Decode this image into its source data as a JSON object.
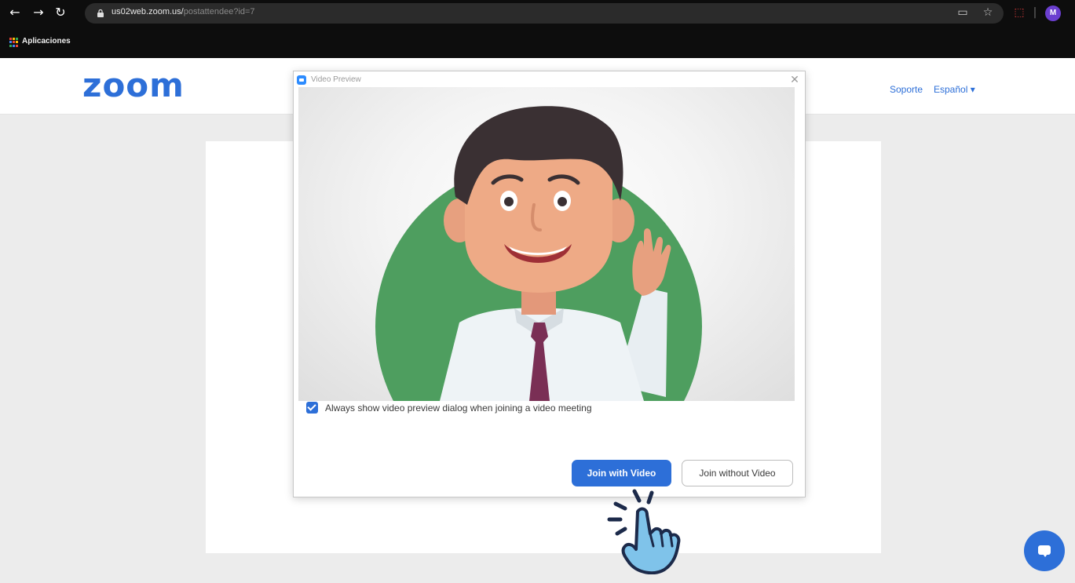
{
  "browser": {
    "url_host": "us02web.zoom.us/",
    "url_path": "postattendee?id=7",
    "back_icon": "back-arrow-icon",
    "forward_icon": "forward-arrow-icon",
    "reload_icon": "reload-icon",
    "profile_initial": "M",
    "bookmarks": {
      "apps_label": "Aplicaciones"
    }
  },
  "header": {
    "logo": "zoom",
    "support_link": "Soporte",
    "language_link": "Español ▾"
  },
  "dialog": {
    "title": "Video Preview",
    "close_label": "✕",
    "checkbox_label": "Always show video preview dialog when joining a video meeting",
    "checkbox_checked": true,
    "join_video_label": "Join with Video",
    "join_without_video_label": "Join without Video"
  },
  "colors": {
    "brand_blue": "#2d6fd8",
    "avatar_green": "#4e9e5f",
    "chrome_bg": "#0d0d0d",
    "page_bg": "#ececec"
  }
}
